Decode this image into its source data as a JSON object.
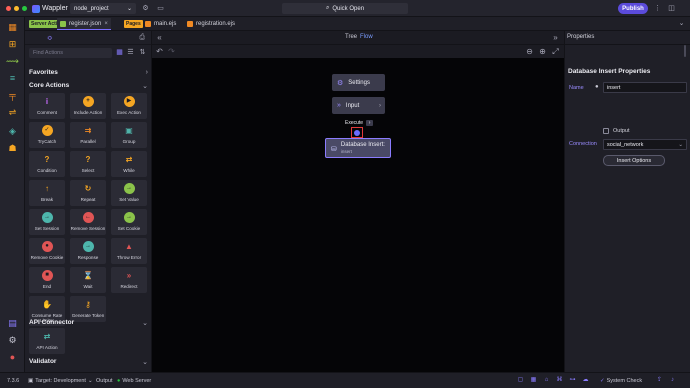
{
  "app": {
    "name": "Wappler",
    "project": "node_project",
    "quick_open": "Quick Open",
    "publish": "Publish"
  },
  "tabs": {
    "server_actions_tag": "Server Actions",
    "pages_tag": "Pages",
    "items": [
      {
        "label": "register.json",
        "close": "×"
      },
      {
        "label": "main.ejs"
      },
      {
        "label": "registration.ejs"
      }
    ]
  },
  "actions_panel": {
    "find_placeholder": "Find Actions",
    "sections": {
      "favorites": "Favorites",
      "core": "Core Actions",
      "api": "API Connector",
      "validator": "Validator"
    },
    "core_actions": [
      {
        "label": "Comment",
        "icon": "info-icon",
        "glyph": "i",
        "color": "#c96cff"
      },
      {
        "label": "Include Action",
        "icon": "plus-circle-icon",
        "glyph": "+",
        "color": "#f5a623"
      },
      {
        "label": "Exec Action",
        "icon": "play-circle-icon",
        "glyph": "▶",
        "color": "#f5a623"
      },
      {
        "label": "TryCatch",
        "icon": "check-circle-icon",
        "glyph": "✓",
        "color": "#f5a623"
      },
      {
        "label": "Parallel",
        "icon": "forward-icon",
        "glyph": "⇉",
        "color": "#f08a24"
      },
      {
        "label": "Group",
        "icon": "group-icon",
        "glyph": "▣",
        "color": "#4fb3a9"
      },
      {
        "label": "Condition",
        "icon": "question-icon",
        "glyph": "?",
        "color": "#f5a623"
      },
      {
        "label": "Select",
        "icon": "question-icon",
        "glyph": "?",
        "color": "#f5a623"
      },
      {
        "label": "While",
        "icon": "loop-icon",
        "glyph": "⇄",
        "color": "#f5a623"
      },
      {
        "label": "Break",
        "icon": "arrow-up-icon",
        "glyph": "↑",
        "color": "#f5a623"
      },
      {
        "label": "Repeat",
        "icon": "repeat-icon",
        "glyph": "↻",
        "color": "#f5a623"
      },
      {
        "label": "Set Value",
        "icon": "arrow-circle-icon",
        "glyph": "→",
        "color": "#8bc34a"
      },
      {
        "label": "Set Session",
        "icon": "arrow-circle-icon",
        "glyph": "→",
        "color": "#4db6ac"
      },
      {
        "label": "Remove Session",
        "icon": "arrow-circle-icon",
        "glyph": "←",
        "color": "#e05555"
      },
      {
        "label": "Set Cookie",
        "icon": "arrow-circle-icon",
        "glyph": "→",
        "color": "#8bc34a"
      },
      {
        "label": "Remove Cookie",
        "icon": "cookie-icon",
        "glyph": "●",
        "color": "#e05555"
      },
      {
        "label": "Response",
        "icon": "arrow-circle-icon",
        "glyph": "→",
        "color": "#4db6ac"
      },
      {
        "label": "Throw Error",
        "icon": "warning-icon",
        "glyph": "▲",
        "color": "#e05555"
      },
      {
        "label": "End",
        "icon": "stop-icon",
        "glyph": "■",
        "color": "#e05555"
      },
      {
        "label": "Wait",
        "icon": "hourglass-icon",
        "glyph": "⌛",
        "color": "#f08a24"
      },
      {
        "label": "Redirect",
        "icon": "redirect-icon",
        "glyph": "»",
        "color": "#e05555"
      },
      {
        "label": "Consume Rate Limiter",
        "icon": "hand-icon",
        "glyph": "✋",
        "color": "#f5a623"
      },
      {
        "label": "Generate Token",
        "icon": "key-icon",
        "glyph": "⚷",
        "color": "#f5a623"
      }
    ],
    "api_actions": [
      {
        "label": "API Action",
        "icon": "api-icon",
        "glyph": "⇄",
        "color": "#4db6ac"
      }
    ]
  },
  "canvas": {
    "tabs": {
      "tree": "Tree",
      "flow": "Flow"
    },
    "nodes": {
      "settings": "Settings",
      "input": "Input",
      "execute": "Execute",
      "db_title": "Database Insert:",
      "db_sub": "insert"
    }
  },
  "properties": {
    "header": "Properties",
    "title": "Database Insert Properties",
    "name_label": "Name",
    "name_value": "insert",
    "output_label": "Output",
    "connection_label": "Connection",
    "connection_value": "social_network",
    "insert_options": "Insert Options"
  },
  "status": {
    "version": "7.3.6",
    "target_label": "Target: Development",
    "output": "Output",
    "web_server": "Web Server",
    "system_check": "System Check"
  },
  "colors": {
    "accent": "#5b4bdb",
    "flow_accent": "#8b7cff",
    "highlight": "#e23a3a"
  }
}
